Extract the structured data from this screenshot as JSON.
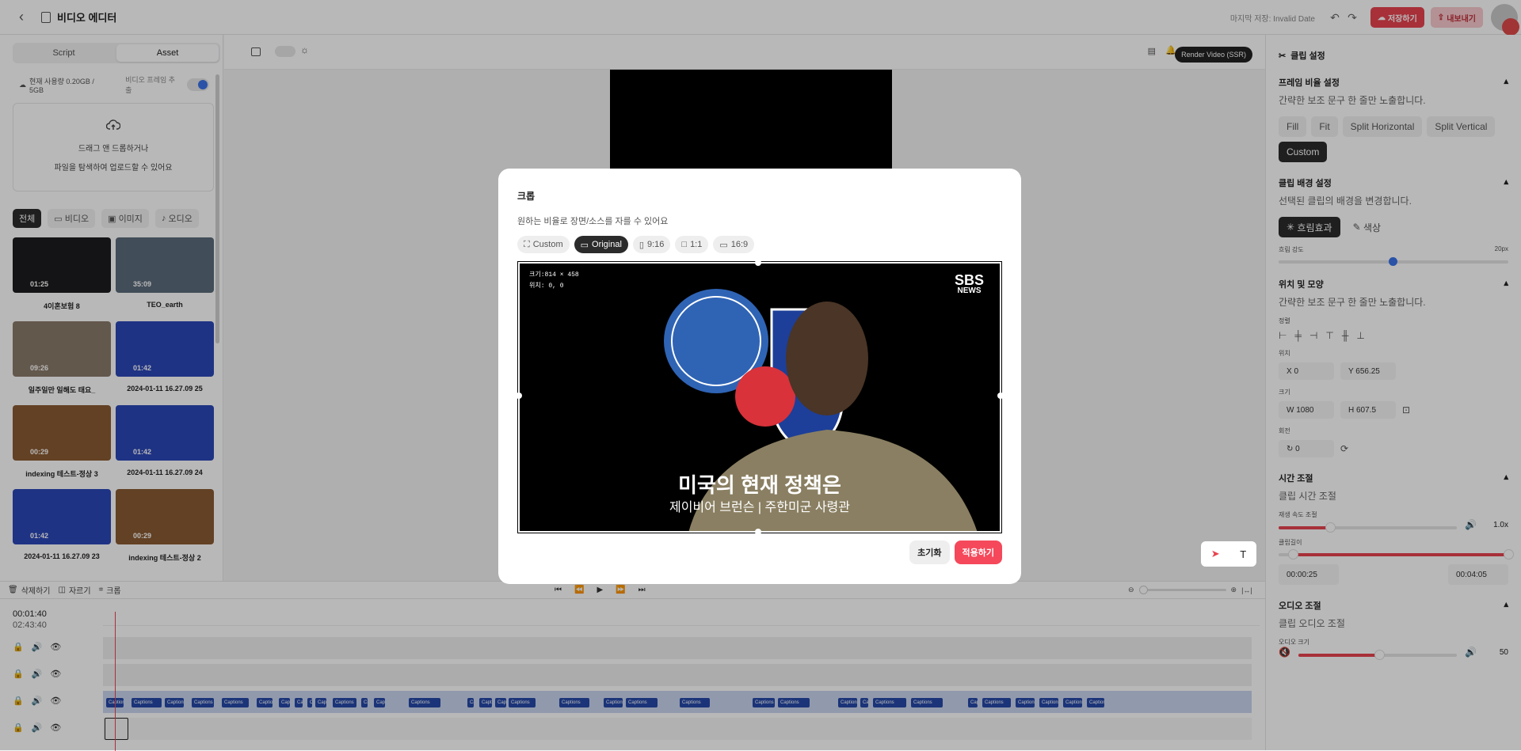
{
  "header": {
    "title": "비디오 에디터",
    "last_saved": "마지막 저장: Invalid Date",
    "save_label": "저장하기",
    "export_label": "내보내기"
  },
  "left": {
    "tabs": [
      "Script",
      "Asset"
    ],
    "usage": "현재 사용량 0.20GB / 5GB",
    "frame_extract": "비디오 프레임 추출",
    "drop_line1": "드래그 앤 드롭하거나",
    "drop_line2": "파일을 탐색하여 업로드할 수 있어요",
    "filters": [
      "전체",
      "비디오",
      "이미지",
      "오디오"
    ],
    "assets": [
      {
        "name": "4이혼보험 8",
        "duration": "01:25",
        "color": "#1d1d1f"
      },
      {
        "name": "TEO_earth",
        "duration": "35:09",
        "color": "#5b6b7a"
      },
      {
        "name": "일주일만 일해도 태요_",
        "duration": "09:26",
        "color": "#8a7a6a"
      },
      {
        "name": "2024-01-11 16.27.09 25",
        "duration": "01:42",
        "color": "#2b47b8"
      },
      {
        "name": "indexing 테스트-정상 3",
        "duration": "00:29",
        "color": "#8a5a32"
      },
      {
        "name": "2024-01-11 16.27.09 24",
        "duration": "01:42",
        "color": "#2b47b8"
      },
      {
        "name": "2024-01-11 16.27.09 23",
        "duration": "01:42",
        "color": "#2b47b8"
      },
      {
        "name": "indexing 테스트-정상 2",
        "duration": "00:29",
        "color": "#8a5a32"
      }
    ]
  },
  "toolbar": {
    "render_label": "Render Video (SSR)",
    "delete_label": "삭제하기",
    "split_label": "자르기",
    "crop_label": "크롭"
  },
  "timeline": {
    "current": "00:01:40",
    "total": "02:43:40",
    "caption_label": "Captions"
  },
  "right": {
    "title": "클립 설정",
    "frame_ratio_title": "프레임 비율 설정",
    "frame_ratio_desc": "간략한 보조 문구 한 줄만 노출합니다.",
    "frame_options": [
      "Fill",
      "Fit",
      "Split Horizontal",
      "Split Vertical",
      "Custom"
    ],
    "bg_title": "클립 배경 설정",
    "bg_desc": "선택된 클립의 배경을 변경합니다.",
    "bg_options": [
      "흐림효과",
      "색상"
    ],
    "blur_label": "흐림 강도",
    "blur_value": "20px",
    "blur_level": 0.5,
    "pos_title": "위치 및 모양",
    "pos_desc": "간략한 보조 문구 한 줄만 노출합니다.",
    "align_label": "정렬",
    "position_label": "위치",
    "x": "X 0",
    "y": "Y 656.25",
    "size_label": "크기",
    "w": "W 1080",
    "h": "H 607.5",
    "rotation_label": "회전",
    "rotation": "0",
    "time_title": "시간 조절",
    "time_desc": "클립 시간 조절",
    "speed_label": "재생 속도 조절",
    "speed_value": "1.0x",
    "length_label": "클립길이",
    "start": "00:00:25",
    "end": "00:04:05",
    "audio_title": "오디오 조절",
    "audio_desc": "클립 오디오 조절",
    "volume_label": "오디오 크기",
    "volume": "50"
  },
  "modal": {
    "title": "크롭",
    "desc": "원하는 비율로 장면/소스를 자를 수 있어요",
    "ratios": [
      "Custom",
      "Original",
      "9:16",
      "1:1",
      "16:9"
    ],
    "info_size": "크기:814 × 458",
    "info_pos": "위치:   0, 0",
    "brand": "SBS",
    "brand_sub": "NEWS",
    "caption_main": "미국의 현재 정책은",
    "caption_sub": "제이비어 브런슨 | 주한미군 사령관",
    "reset_label": "초기화",
    "apply_label": "적용하기"
  }
}
